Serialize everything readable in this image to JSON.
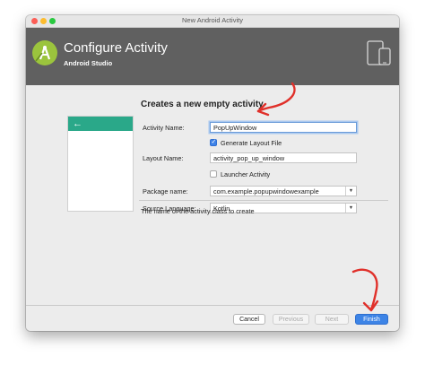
{
  "window": {
    "title": "New Android Activity"
  },
  "header": {
    "title": "Configure Activity",
    "subtitle": "Android Studio"
  },
  "form": {
    "heading": "Creates a new empty activity",
    "activity_name": {
      "label": "Activity Name:",
      "value": "PopUpWindow"
    },
    "generate_layout": {
      "label": "Generate Layout File",
      "checked": true
    },
    "layout_name": {
      "label": "Layout Name:",
      "value": "activity_pop_up_window"
    },
    "launcher_activity": {
      "label": "Launcher Activity",
      "checked": false
    },
    "package_name": {
      "label": "Package name:",
      "value": "com.example.popupwindowexample"
    },
    "source_language": {
      "label": "Source Language:",
      "value": "Kotlin"
    }
  },
  "preview": {
    "back_glyph": "←"
  },
  "hint": "The name of the activity class to create",
  "buttons": {
    "cancel": "Cancel",
    "previous": "Previous",
    "next": "Next",
    "finish": "Finish"
  },
  "colors": {
    "header_bg": "#606060",
    "preview_bar": "#2aa889",
    "accent_blue": "#3d84e6",
    "annotation_red": "#e0302a",
    "android_green": "#9bc43d"
  },
  "icons": {
    "logo": "android-studio-logo",
    "device": "device-form-factor-icon",
    "back": "back-arrow-icon",
    "dropdown": "chevron-down-icon"
  }
}
